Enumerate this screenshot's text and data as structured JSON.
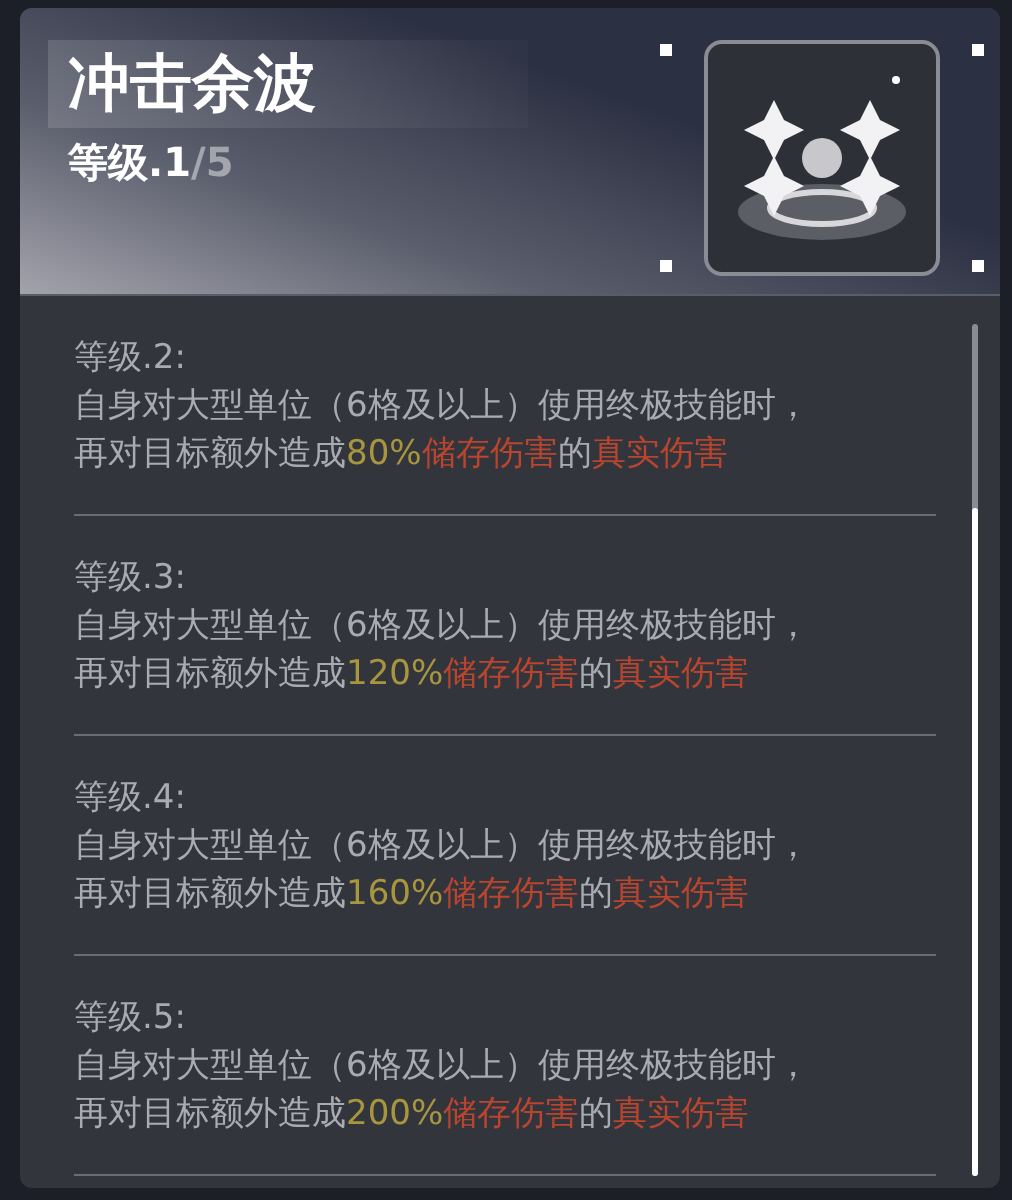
{
  "header": {
    "title": "冲击余波",
    "level": "等级.1",
    "max_level": "/5"
  },
  "levels": [
    {
      "title": "等级.2:",
      "line_1": "自身对大型单位（6格及以上）使用终极技能时，",
      "line_2": [
        {
          "text": "再对目标额外造成",
          "kind": "plain"
        },
        {
          "text": "80%",
          "kind": "value"
        },
        {
          "text": "储存伤害",
          "kind": "damage"
        },
        {
          "text": "的",
          "kind": "plain"
        },
        {
          "text": "真实伤害",
          "kind": "damage"
        }
      ]
    },
    {
      "title": "等级.3:",
      "line_1": "自身对大型单位（6格及以上）使用终极技能时，",
      "line_2": [
        {
          "text": "再对目标额外造成",
          "kind": "plain"
        },
        {
          "text": "120%",
          "kind": "value"
        },
        {
          "text": "储存伤害",
          "kind": "damage"
        },
        {
          "text": "的",
          "kind": "plain"
        },
        {
          "text": "真实伤害",
          "kind": "damage"
        }
      ]
    },
    {
      "title": "等级.4:",
      "line_1": "自身对大型单位（6格及以上）使用终极技能时，",
      "line_2": [
        {
          "text": "再对目标额外造成",
          "kind": "plain"
        },
        {
          "text": "160%",
          "kind": "value"
        },
        {
          "text": "储存伤害",
          "kind": "damage"
        },
        {
          "text": "的",
          "kind": "plain"
        },
        {
          "text": "真实伤害",
          "kind": "damage"
        }
      ]
    },
    {
      "title": "等级.5:",
      "line_1": "自身对大型单位（6格及以上）使用终极技能时，",
      "line_2": [
        {
          "text": "再对目标额外造成",
          "kind": "plain"
        },
        {
          "text": "200%",
          "kind": "value"
        },
        {
          "text": "储存伤害",
          "kind": "damage"
        },
        {
          "text": "的",
          "kind": "plain"
        },
        {
          "text": "真实伤害",
          "kind": "damage"
        }
      ]
    }
  ]
}
